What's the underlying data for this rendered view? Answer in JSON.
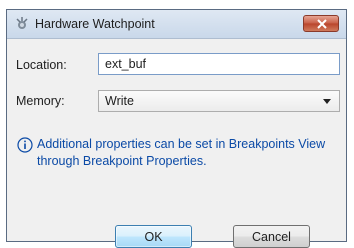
{
  "window": {
    "title": "Hardware Watchpoint",
    "close_glyph": "✕"
  },
  "form": {
    "location_label": "Location:",
    "location_value": "ext_buf",
    "memory_label": "Memory:",
    "memory_value": "Write"
  },
  "info": {
    "icon": "info-icon",
    "text": "Additional properties can be set in Breakpoints View through Breakpoint Properties."
  },
  "buttons": {
    "ok_label": "OK",
    "cancel_label": "Cancel"
  },
  "colors": {
    "info_text": "#0b4aa6",
    "close_button": "#c75d44",
    "ok_border": "#3c7fb1"
  }
}
